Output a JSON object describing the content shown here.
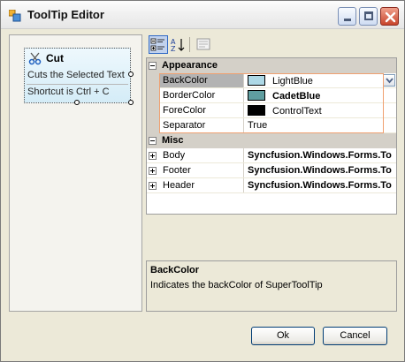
{
  "window": {
    "title": "ToolTip Editor",
    "icons": {
      "app": "app-icon",
      "minimize": "minimize-icon",
      "maximize": "maximize-icon",
      "close": "close-icon"
    }
  },
  "preview": {
    "tooltip": {
      "icon": "scissors-icon",
      "title": "Cut",
      "body": "Cuts the Selected Text",
      "footer": "Shortcut is Ctrl + C"
    }
  },
  "toolbar": {
    "buttons": [
      "categorized-icon",
      "alphabetical-icon",
      "property-pages-icon"
    ]
  },
  "property_grid": {
    "categories": [
      {
        "name": "Appearance",
        "properties": [
          {
            "name": "BackColor",
            "value": "LightBlue",
            "swatch": "#add8e6",
            "selected": true
          },
          {
            "name": "BorderColor",
            "value": "CadetBlue",
            "swatch": "#5f9ea0",
            "bold": true
          },
          {
            "name": "ForeColor",
            "value": "ControlText",
            "swatch": "#000000"
          },
          {
            "name": "Separator",
            "value": "True"
          }
        ]
      },
      {
        "name": "Misc",
        "properties": [
          {
            "name": "Body",
            "value": "Syncfusion.Windows.Forms.To",
            "bold": true
          },
          {
            "name": "Footer",
            "value": "Syncfusion.Windows.Forms.To",
            "bold": true
          },
          {
            "name": "Header",
            "value": "Syncfusion.Windows.Forms.To",
            "bold": true
          }
        ]
      }
    ],
    "description": {
      "title": "BackColor",
      "text": "Indicates the backColor of SuperToolTip"
    }
  },
  "buttons": {
    "ok": "Ok",
    "cancel": "Cancel"
  },
  "colors": {
    "window_bg": "#ece9d8",
    "tooltip_bg": "#d4ecf7",
    "selection": "#b3b3b3",
    "edit_highlight": "#f0a070"
  }
}
